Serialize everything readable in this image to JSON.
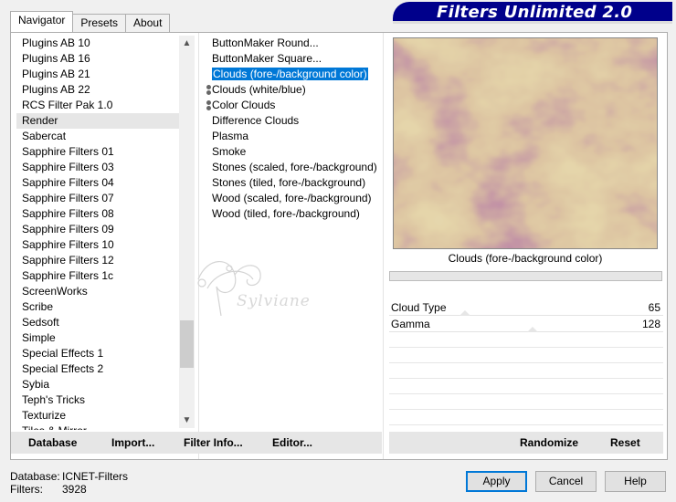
{
  "title": "Filters Unlimited 2.0",
  "tabs": [
    "Navigator",
    "Presets",
    "About"
  ],
  "categories": [
    "Plugins AB 10",
    "Plugins AB 16",
    "Plugins AB 21",
    "Plugins AB 22",
    "RCS Filter Pak 1.0",
    "Render",
    "Sabercat",
    "Sapphire Filters 01",
    "Sapphire Filters 03",
    "Sapphire Filters 04",
    "Sapphire Filters 07",
    "Sapphire Filters 08",
    "Sapphire Filters 09",
    "Sapphire Filters 10",
    "Sapphire Filters 12",
    "Sapphire Filters 1c",
    "ScreenWorks",
    "Scribe",
    "Sedsoft",
    "Simple",
    "Special Effects 1",
    "Special Effects 2",
    "Sybia",
    "Teph's Tricks",
    "Texturize",
    "Tiles & Mirror"
  ],
  "selected_category": "Render",
  "filters": [
    "ButtonMaker Round...",
    "ButtonMaker Square...",
    "Clouds (fore-/background color)",
    "Clouds (white/blue)",
    "Color Clouds",
    "Difference Clouds",
    "Plasma",
    "Smoke",
    "Stones (scaled, fore-/background)",
    "Stones (tiled, fore-/background)",
    "Wood (scaled, fore-/background)",
    "Wood (tiled, fore-/background)"
  ],
  "selected_filter": "Clouds (fore-/background color)",
  "preview_label": "Clouds (fore-/background color)",
  "preview_colors": {
    "base": "#c09a58",
    "purple": "#7a2c6c",
    "light": "#d2b46e"
  },
  "params": [
    {
      "label": "Cloud Type",
      "value": "65",
      "level": 0.255
    },
    {
      "label": "Gamma",
      "value": "128",
      "level": 0.502
    }
  ],
  "links": {
    "database": "Database",
    "import": "Import...",
    "filter_info": "Filter Info...",
    "editor": "Editor...",
    "randomize": "Randomize",
    "reset": "Reset"
  },
  "status": {
    "database_label": "Database:",
    "database_value": "ICNET-Filters",
    "filters_label": "Filters:",
    "filters_value": "3928"
  },
  "buttons": {
    "apply": "Apply",
    "cancel": "Cancel",
    "help": "Help"
  },
  "watermark": "Sylviane",
  "icons": {
    "scroll_up": "chevron-up-icon",
    "scroll_down": "chevron-down-icon"
  }
}
